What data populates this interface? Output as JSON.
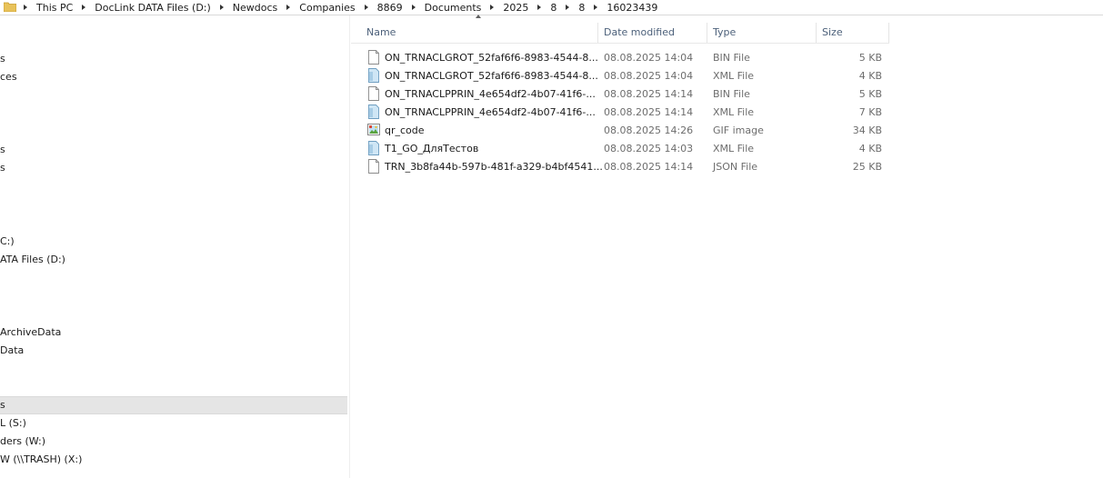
{
  "breadcrumb": [
    "This PC",
    "DocLink DATA Files (D:)",
    "Newdocs",
    "Companies",
    "8869",
    "Documents",
    "2025",
    "8",
    "8",
    "16023439"
  ],
  "nav": [
    {
      "label": "s",
      "selected": false
    },
    {
      "label": "ces",
      "selected": false
    },
    {
      "label": "s",
      "selected": false
    },
    {
      "label": "s",
      "selected": false
    },
    {
      "label": "C:)",
      "selected": false
    },
    {
      "label": "ATA Files (D:)",
      "selected": false
    },
    {
      "label": "ArchiveData",
      "selected": false
    },
    {
      "label": "Data",
      "selected": false
    },
    {
      "label": "s",
      "selected": true
    },
    {
      "label": "L (S:)",
      "selected": false
    },
    {
      "label": "ders (W:)",
      "selected": false
    },
    {
      "label": "W (\\\\TRASH) (X:)",
      "selected": false
    }
  ],
  "columns": {
    "name": "Name",
    "date": "Date modified",
    "type": "Type",
    "size": "Size"
  },
  "files": [
    {
      "name": "ON_TRNACLGROT_52faf6f6-8983-4544-8...",
      "date": "08.08.2025 14:04",
      "type": "BIN File",
      "size": "5 KB",
      "icon": "blank-file-icon"
    },
    {
      "name": "ON_TRNACLGROT_52faf6f6-8983-4544-8...",
      "date": "08.08.2025 14:04",
      "type": "XML File",
      "size": "4 KB",
      "icon": "xml-file-icon"
    },
    {
      "name": "ON_TRNACLPPRIN_4e654df2-4b07-41f6-...",
      "date": "08.08.2025 14:14",
      "type": "BIN File",
      "size": "5 KB",
      "icon": "blank-file-icon"
    },
    {
      "name": "ON_TRNACLPPRIN_4e654df2-4b07-41f6-...",
      "date": "08.08.2025 14:14",
      "type": "XML File",
      "size": "7 KB",
      "icon": "xml-file-icon"
    },
    {
      "name": "qr_code",
      "date": "08.08.2025 14:26",
      "type": "GIF image",
      "size": "34 KB",
      "icon": "image-file-icon"
    },
    {
      "name": "T1_GO_ДляТестов",
      "date": "08.08.2025 14:03",
      "type": "XML File",
      "size": "4 KB",
      "icon": "xml-file-icon"
    },
    {
      "name": "TRN_3b8fa44b-597b-481f-a329-b4bf4541...",
      "date": "08.08.2025 14:14",
      "type": "JSON File",
      "size": "25 KB",
      "icon": "blank-file-icon"
    }
  ],
  "colors": {
    "header_text": "#4c607a",
    "meta_text": "#6d6d6d",
    "selection": "#e5e5e5"
  }
}
